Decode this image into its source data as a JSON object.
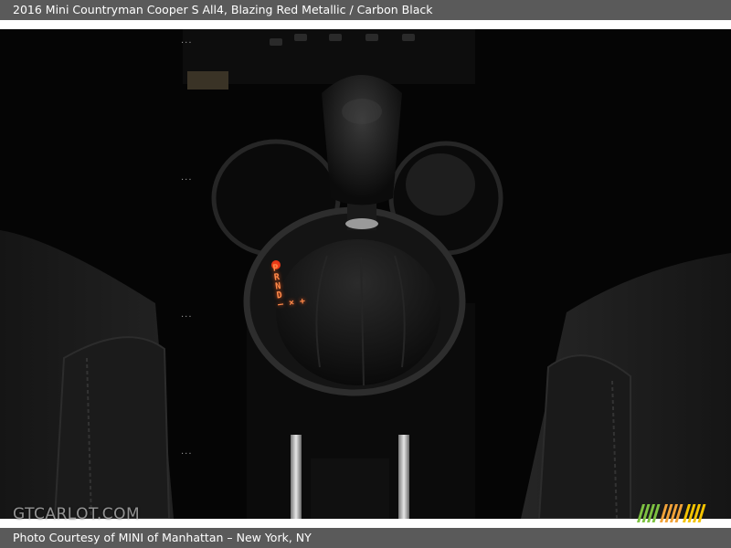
{
  "header": {
    "title": "2016 Mini Countryman Cooper S All4,   Blazing Red Metallic / Carbon Black"
  },
  "photo": {
    "gear_indicator_lines": [
      "P",
      "R",
      "N",
      "D",
      "– × +"
    ]
  },
  "watermark": {
    "text": "GTCARLOT.COM"
  },
  "footer": {
    "credit": "Photo Courtesy of MINI of Manhattan – New York, NY"
  },
  "logo": {
    "name": "gtcarlot-stripes-logo",
    "colors": [
      "#7ec242",
      "#f2a33a",
      "#f5c400"
    ]
  }
}
